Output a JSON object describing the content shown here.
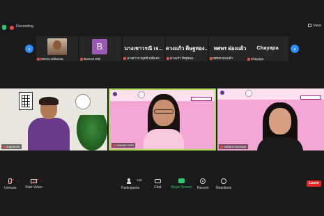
{
  "top": {
    "recording_label": "Recording",
    "view_label": "View"
  },
  "strip": {
    "thumbnails": [
      {
        "name": "Meena Srikumar",
        "big": ""
      },
      {
        "name": "Boonsri Kitti",
        "big": "B"
      },
      {
        "name": "นางสาวกาญจนี มณีแสง",
        "big": "นางเชาวรณี เจ..."
      },
      {
        "name": "ดวงแก้ว ดิษฐทอง...",
        "big": "ดวงแก้ว ดิษฐทอง..."
      },
      {
        "name": "ทศพร ผ่องแผ้ว",
        "big": "ทศพร ผ่องแผ้ว"
      },
      {
        "name": "Chayapa",
        "big": "Chayapa"
      }
    ]
  },
  "tiles": [
    {
      "name": "supannee"
    },
    {
      "name": "Saisiam Kitti"
    },
    {
      "name": "Saitara Nuampa"
    }
  ],
  "toolbar": {
    "unmute": "Unmute",
    "start_video": "Start Video",
    "participants": "Participants",
    "participants_count": "138",
    "chat": "Chat",
    "share_screen": "Share Screen",
    "record": "Record",
    "reactions": "Reactions",
    "leave": "Leave"
  },
  "colors": {
    "accent": "#2d8cff",
    "share": "#2ecc71",
    "leave": "#e02828",
    "active_speaker": "#a8e04a"
  }
}
